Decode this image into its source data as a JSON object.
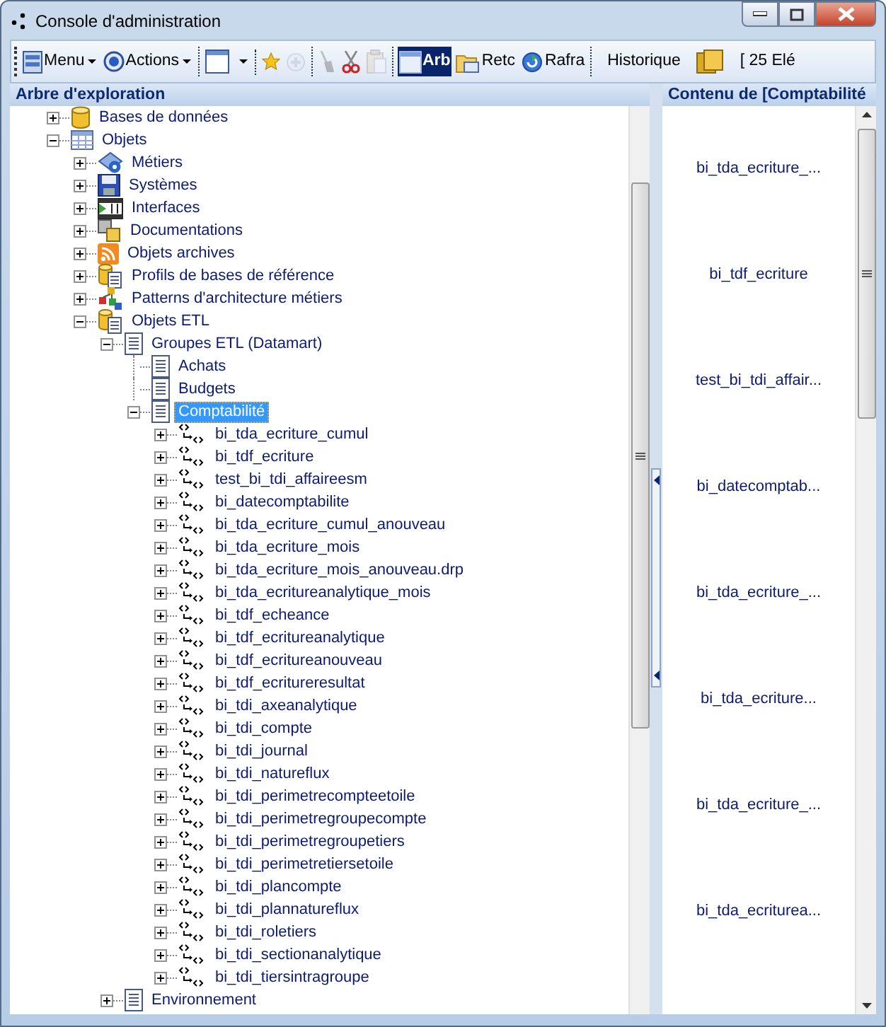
{
  "window": {
    "title": "Console d'administration"
  },
  "toolbar": {
    "groups": [
      [
        {
          "kind": "menu",
          "label": "Menu"
        },
        {
          "kind": "actions",
          "label": "Actions"
        }
      ],
      [
        {
          "kind": "window-dropdown"
        }
      ],
      [
        {
          "kind": "favorite",
          "disabled": false
        },
        {
          "kind": "add",
          "disabled": true
        }
      ],
      [
        {
          "kind": "clean",
          "disabled": true
        },
        {
          "kind": "cut",
          "disabled": false
        },
        {
          "kind": "paste",
          "disabled": true
        }
      ],
      [
        {
          "kind": "tree-view",
          "label": "Arb",
          "pressed": true
        },
        {
          "kind": "return",
          "label": "Retc",
          "pressed": false
        },
        {
          "kind": "refresh",
          "label": "Rafra",
          "pressed": false
        }
      ],
      [
        {
          "kind": "history",
          "label": "Historique"
        },
        {
          "kind": "folder"
        },
        {
          "kind": "count",
          "label": "[ 25 Elé"
        }
      ]
    ]
  },
  "tree_panel": {
    "title": "Arbre d'exploration",
    "tree": [
      {
        "label": "Bases de données",
        "kind": "database",
        "expanded": false,
        "selected": false
      },
      {
        "label": "Objets",
        "kind": "grid",
        "expanded": true,
        "selected": false,
        "children": [
          {
            "label": "Métiers",
            "kind": "metiers",
            "expanded": false,
            "selected": false
          },
          {
            "label": "Systèmes",
            "kind": "disk",
            "expanded": false,
            "selected": false
          },
          {
            "label": "Interfaces",
            "kind": "film",
            "expanded": false,
            "selected": false
          },
          {
            "label": "Documentations",
            "kind": "docs",
            "expanded": false,
            "selected": false
          },
          {
            "label": "Objets archives",
            "kind": "rss",
            "expanded": false,
            "selected": false
          },
          {
            "label": "Profils de bases de référence",
            "kind": "profile",
            "expanded": false,
            "selected": false
          },
          {
            "label": "Patterns d'architecture métiers",
            "kind": "patterns",
            "expanded": false,
            "selected": false
          },
          {
            "label": "Objets ETL",
            "kind": "profile",
            "expanded": true,
            "selected": false,
            "children": [
              {
                "label": "Groupes ETL (Datamart)",
                "kind": "page",
                "expanded": true,
                "selected": false,
                "children": [
                  {
                    "label": "Achats",
                    "kind": "page",
                    "selected": false
                  },
                  {
                    "label": "Budgets",
                    "kind": "page",
                    "selected": false
                  },
                  {
                    "label": "Comptabilité",
                    "kind": "page",
                    "expanded": true,
                    "selected": true,
                    "children": [
                      {
                        "label": "bi_tda_ecriture_cumul",
                        "kind": "etl",
                        "expanded": false,
                        "selected": false
                      },
                      {
                        "label": "bi_tdf_ecriture",
                        "kind": "etl",
                        "expanded": false,
                        "selected": false
                      },
                      {
                        "label": "test_bi_tdi_affaireesm",
                        "kind": "etl",
                        "expanded": false,
                        "selected": false
                      },
                      {
                        "label": "bi_datecomptabilite",
                        "kind": "etl",
                        "expanded": false,
                        "selected": false
                      },
                      {
                        "label": "bi_tda_ecriture_cumul_anouveau",
                        "kind": "etl",
                        "expanded": false,
                        "selected": false
                      },
                      {
                        "label": "bi_tda_ecriture_mois",
                        "kind": "etl",
                        "expanded": false,
                        "selected": false
                      },
                      {
                        "label": "bi_tda_ecriture_mois_anouveau.drp",
                        "kind": "etl",
                        "expanded": false,
                        "selected": false
                      },
                      {
                        "label": "bi_tda_ecritureanalytique_mois",
                        "kind": "etl",
                        "expanded": false,
                        "selected": false
                      },
                      {
                        "label": "bi_tdf_echeance",
                        "kind": "etl",
                        "expanded": false,
                        "selected": false
                      },
                      {
                        "label": "bi_tdf_ecritureanalytique",
                        "kind": "etl",
                        "expanded": false,
                        "selected": false
                      },
                      {
                        "label": "bi_tdf_ecritureanouveau",
                        "kind": "etl",
                        "expanded": false,
                        "selected": false
                      },
                      {
                        "label": "bi_tdf_ecritureresultat",
                        "kind": "etl",
                        "expanded": false,
                        "selected": false
                      },
                      {
                        "label": "bi_tdi_axeanalytique",
                        "kind": "etl",
                        "expanded": false,
                        "selected": false
                      },
                      {
                        "label": "bi_tdi_compte",
                        "kind": "etl",
                        "expanded": false,
                        "selected": false
                      },
                      {
                        "label": "bi_tdi_journal",
                        "kind": "etl",
                        "expanded": false,
                        "selected": false
                      },
                      {
                        "label": "bi_tdi_natureflux",
                        "kind": "etl",
                        "expanded": false,
                        "selected": false
                      },
                      {
                        "label": "bi_tdi_perimetrecompteetoile",
                        "kind": "etl",
                        "expanded": false,
                        "selected": false
                      },
                      {
                        "label": "bi_tdi_perimetregroupecompte",
                        "kind": "etl",
                        "expanded": false,
                        "selected": false
                      },
                      {
                        "label": "bi_tdi_perimetregroupetiers",
                        "kind": "etl",
                        "expanded": false,
                        "selected": false
                      },
                      {
                        "label": "bi_tdi_perimetretiersetoile",
                        "kind": "etl",
                        "expanded": false,
                        "selected": false
                      },
                      {
                        "label": "bi_tdi_plancompte",
                        "kind": "etl",
                        "expanded": false,
                        "selected": false
                      },
                      {
                        "label": "bi_tdi_plannatureflux",
                        "kind": "etl",
                        "expanded": false,
                        "selected": false
                      },
                      {
                        "label": "bi_tdi_roletiers",
                        "kind": "etl",
                        "expanded": false,
                        "selected": false
                      },
                      {
                        "label": "bi_tdi_sectionanalytique",
                        "kind": "etl",
                        "expanded": false,
                        "selected": false
                      },
                      {
                        "label": "bi_tdi_tiersintragroupe",
                        "kind": "etl",
                        "expanded": false,
                        "selected": false
                      }
                    ]
                  }
                ]
              },
              {
                "label": "Environnement",
                "kind": "page",
                "expanded": false,
                "selected": false
              }
            ]
          }
        ]
      }
    ]
  },
  "content_panel": {
    "title": "Contenu de [Comptabilité",
    "items": [
      "bi_tda_ecriture_...",
      "bi_tdf_ecriture",
      "test_bi_tdi_affair...",
      "bi_datecomptab...",
      "bi_tda_ecriture_...",
      "bi_tda_ecriture...",
      "bi_tda_ecriture_...",
      "bi_tda_ecriturea..."
    ]
  }
}
